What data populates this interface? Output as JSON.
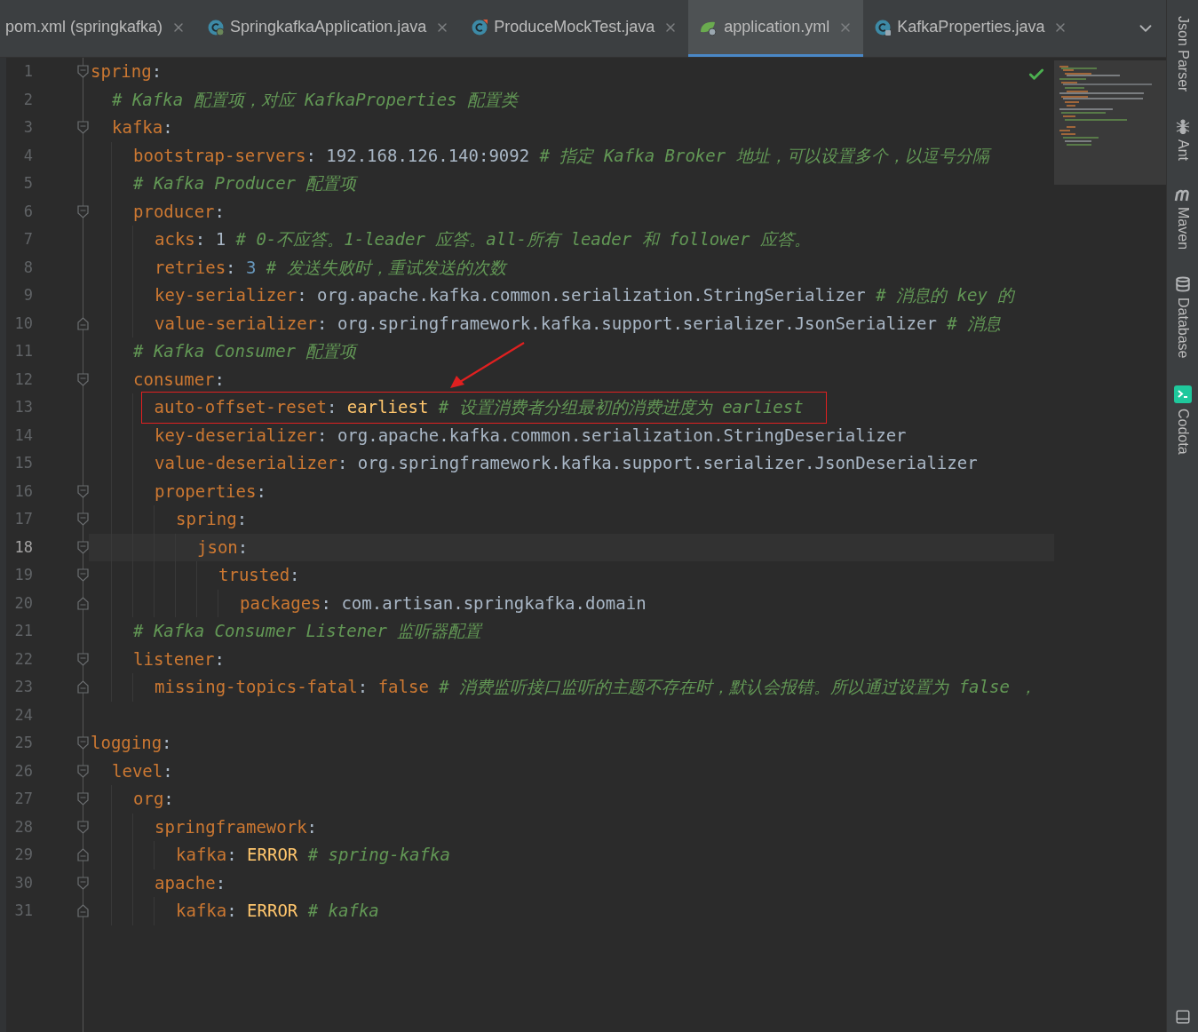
{
  "tabs": [
    {
      "label": "pom.xml (springkafka)",
      "kind": "plain",
      "selected": false
    },
    {
      "label": "SpringkafkaApplication.java",
      "kind": "springclass",
      "selected": false
    },
    {
      "label": "ProduceMockTest.java",
      "kind": "testclass",
      "selected": false
    },
    {
      "label": "application.yml",
      "kind": "yml",
      "selected": true
    },
    {
      "label": "KafkaProperties.java",
      "kind": "lockedclass",
      "selected": false
    }
  ],
  "editor": {
    "lines": [
      {
        "number": "1",
        "fold_start": true,
        "tokens": [
          {
            "kind": "key",
            "text": "spring"
          },
          {
            "kind": "punct",
            "text": ":"
          }
        ],
        "children": [
          {
            "number": "2",
            "tokens": [
              {
                "kind": "comment",
                "text": "# Kafka 配置项，对应 KafkaProperties 配置类"
              }
            ]
          },
          {
            "number": "3",
            "fold_start": true,
            "tokens": [
              {
                "kind": "key",
                "text": "kafka"
              },
              {
                "kind": "punct",
                "text": ":"
              }
            ],
            "children": [
              {
                "number": "4",
                "tokens": [
                  {
                    "kind": "key",
                    "text": "bootstrap-servers"
                  },
                  {
                    "kind": "punct",
                    "text": ":"
                  },
                  {
                    "kind": "text",
                    "text": "192.168.126.140:9092"
                  },
                  {
                    "kind": "comment",
                    "text": "# 指定 Kafka Broker 地址，可以设置多个，以逗号分隔"
                  }
                ]
              },
              {
                "number": "5",
                "tokens": [
                  {
                    "kind": "comment",
                    "text": "# Kafka Producer 配置项"
                  }
                ]
              },
              {
                "number": "6",
                "fold_start": true,
                "tokens": [
                  {
                    "kind": "key",
                    "text": "producer"
                  },
                  {
                    "kind": "punct",
                    "text": ":"
                  }
                ],
                "children": [
                  {
                    "number": "7",
                    "tokens": [
                      {
                        "kind": "key",
                        "text": "acks"
                      },
                      {
                        "kind": "punct",
                        "text": ":"
                      },
                      {
                        "kind": "text",
                        "text": "1"
                      },
                      {
                        "kind": "comment",
                        "text": "# 0-不应答。1-leader 应答。all-所有 leader 和 follower 应答。"
                      }
                    ]
                  },
                  {
                    "number": "8",
                    "tokens": [
                      {
                        "kind": "key",
                        "text": "retries"
                      },
                      {
                        "kind": "punct",
                        "text": ":"
                      },
                      {
                        "kind": "number",
                        "text": "3"
                      },
                      {
                        "kind": "comment",
                        "text": "# 发送失败时，重试发送的次数"
                      }
                    ]
                  },
                  {
                    "number": "9",
                    "tokens": [
                      {
                        "kind": "key",
                        "text": "key-serializer"
                      },
                      {
                        "kind": "punct",
                        "text": ":"
                      },
                      {
                        "kind": "text",
                        "text": "org.apache.kafka.common.serialization.StringSerializer"
                      },
                      {
                        "kind": "comment",
                        "text": "# 消息的 key 的"
                      }
                    ]
                  },
                  {
                    "number": "10",
                    "fold_end": true,
                    "tokens": [
                      {
                        "kind": "key",
                        "text": "value-serializer"
                      },
                      {
                        "kind": "punct",
                        "text": ":"
                      },
                      {
                        "kind": "text",
                        "text": "org.springframework.kafka.support.serializer.JsonSerializer"
                      },
                      {
                        "kind": "comment",
                        "text": "# 消息"
                      }
                    ]
                  }
                ]
              },
              {
                "number": "11",
                "tokens": [
                  {
                    "kind": "comment",
                    "text": "# Kafka Consumer 配置项"
                  }
                ]
              },
              {
                "number": "12",
                "fold_start": true,
                "tokens": [
                  {
                    "kind": "key",
                    "text": "consumer"
                  },
                  {
                    "kind": "punct",
                    "text": ":"
                  }
                ],
                "children": [
                  {
                    "number": "13",
                    "highlighted": true,
                    "tokens": [
                      {
                        "kind": "key",
                        "text": "auto-offset-reset"
                      },
                      {
                        "kind": "punct",
                        "text": ":"
                      },
                      {
                        "kind": "constant",
                        "text": "earliest"
                      },
                      {
                        "kind": "comment",
                        "text": "# 设置消费者分组最初的消费进度为 earliest"
                      }
                    ]
                  },
                  {
                    "number": "14",
                    "tokens": [
                      {
                        "kind": "key",
                        "text": "key-deserializer"
                      },
                      {
                        "kind": "punct",
                        "text": ":"
                      },
                      {
                        "kind": "text",
                        "text": "org.apache.kafka.common.serialization.StringDeserializer"
                      }
                    ]
                  },
                  {
                    "number": "15",
                    "tokens": [
                      {
                        "kind": "key",
                        "text": "value-deserializer"
                      },
                      {
                        "kind": "punct",
                        "text": ":"
                      },
                      {
                        "kind": "text",
                        "text": "org.springframework.kafka.support.serializer.JsonDeserializer"
                      }
                    ]
                  },
                  {
                    "number": "16",
                    "fold_start": true,
                    "tokens": [
                      {
                        "kind": "key",
                        "text": "properties"
                      },
                      {
                        "kind": "punct",
                        "text": ":"
                      }
                    ],
                    "children": [
                      {
                        "number": "17",
                        "fold_start": true,
                        "tokens": [
                          {
                            "kind": "key",
                            "text": "spring"
                          },
                          {
                            "kind": "punct",
                            "text": ":"
                          }
                        ],
                        "children": [
                          {
                            "number": "18",
                            "fold_start": true,
                            "current": true,
                            "tokens": [
                              {
                                "kind": "key",
                                "text": "json"
                              },
                              {
                                "kind": "punct",
                                "text": ":"
                              }
                            ],
                            "children": [
                              {
                                "number": "19",
                                "fold_start": true,
                                "tokens": [
                                  {
                                    "kind": "key",
                                    "text": "trusted"
                                  },
                                  {
                                    "kind": "punct",
                                    "text": ":"
                                  }
                                ],
                                "children": [
                                  {
                                    "number": "20",
                                    "fold_end": true,
                                    "tokens": [
                                      {
                                        "kind": "key",
                                        "text": "packages"
                                      },
                                      {
                                        "kind": "punct",
                                        "text": ":"
                                      },
                                      {
                                        "kind": "text",
                                        "text": "com.artisan.springkafka.domain"
                                      }
                                    ]
                                  }
                                ]
                              }
                            ]
                          }
                        ]
                      }
                    ]
                  }
                ]
              },
              {
                "number": "21",
                "tokens": [
                  {
                    "kind": "comment",
                    "text": "# Kafka Consumer Listener 监听器配置"
                  }
                ]
              },
              {
                "number": "22",
                "fold_start": true,
                "tokens": [
                  {
                    "kind": "key",
                    "text": "listener"
                  },
                  {
                    "kind": "punct",
                    "text": ":"
                  }
                ],
                "children": [
                  {
                    "number": "23",
                    "fold_end": true,
                    "tokens": [
                      {
                        "kind": "key",
                        "text": "missing-topics-fatal"
                      },
                      {
                        "kind": "punct",
                        "text": ":"
                      },
                      {
                        "kind": "keyword",
                        "text": "false"
                      },
                      {
                        "kind": "comment",
                        "text": "# 消费监听接口监听的主题不存在时，默认会报错。所以通过设置为 false ，"
                      }
                    ]
                  }
                ]
              }
            ]
          }
        ]
      },
      {
        "number": "24"
      },
      {
        "number": "25",
        "fold_start": true,
        "tokens": [
          {
            "kind": "key",
            "text": "logging"
          },
          {
            "kind": "punct",
            "text": ":"
          }
        ],
        "children": [
          {
            "number": "26",
            "fold_start": true,
            "tokens": [
              {
                "kind": "key",
                "text": "level"
              },
              {
                "kind": "punct",
                "text": ":"
              }
            ],
            "children": [
              {
                "number": "27",
                "fold_start": true,
                "tokens": [
                  {
                    "kind": "key",
                    "text": "org"
                  },
                  {
                    "kind": "punct",
                    "text": ":"
                  }
                ],
                "children": [
                  {
                    "number": "28",
                    "fold_start": true,
                    "tokens": [
                      {
                        "kind": "key",
                        "text": "springframework"
                      },
                      {
                        "kind": "punct",
                        "text": ":"
                      }
                    ],
                    "children": [
                      {
                        "number": "29",
                        "fold_end": true,
                        "tokens": [
                          {
                            "kind": "key",
                            "text": "kafka"
                          },
                          {
                            "kind": "punct",
                            "text": ":"
                          },
                          {
                            "kind": "constant",
                            "text": "ERROR"
                          },
                          {
                            "kind": "comment",
                            "text": "# spring-kafka"
                          }
                        ]
                      }
                    ]
                  },
                  {
                    "number": "30",
                    "fold_start": true,
                    "tokens": [
                      {
                        "kind": "key",
                        "text": "apache"
                      },
                      {
                        "kind": "punct",
                        "text": ":"
                      }
                    ],
                    "children": [
                      {
                        "number": "31",
                        "fold_end": true,
                        "tokens": [
                          {
                            "kind": "key",
                            "text": "kafka"
                          },
                          {
                            "kind": "punct",
                            "text": ":"
                          },
                          {
                            "kind": "constant",
                            "text": "ERROR"
                          },
                          {
                            "kind": "comment",
                            "text": "# kafka"
                          }
                        ]
                      }
                    ]
                  }
                ]
              }
            ]
          }
        ]
      }
    ]
  },
  "side_tools": [
    {
      "label": "Json Parser",
      "kind": "plain"
    },
    {
      "label": "Ant",
      "kind": "ant"
    },
    {
      "label": "Maven",
      "kind": "maven"
    },
    {
      "label": "Database",
      "kind": "database"
    },
    {
      "label": "Codota",
      "kind": "codota"
    }
  ]
}
